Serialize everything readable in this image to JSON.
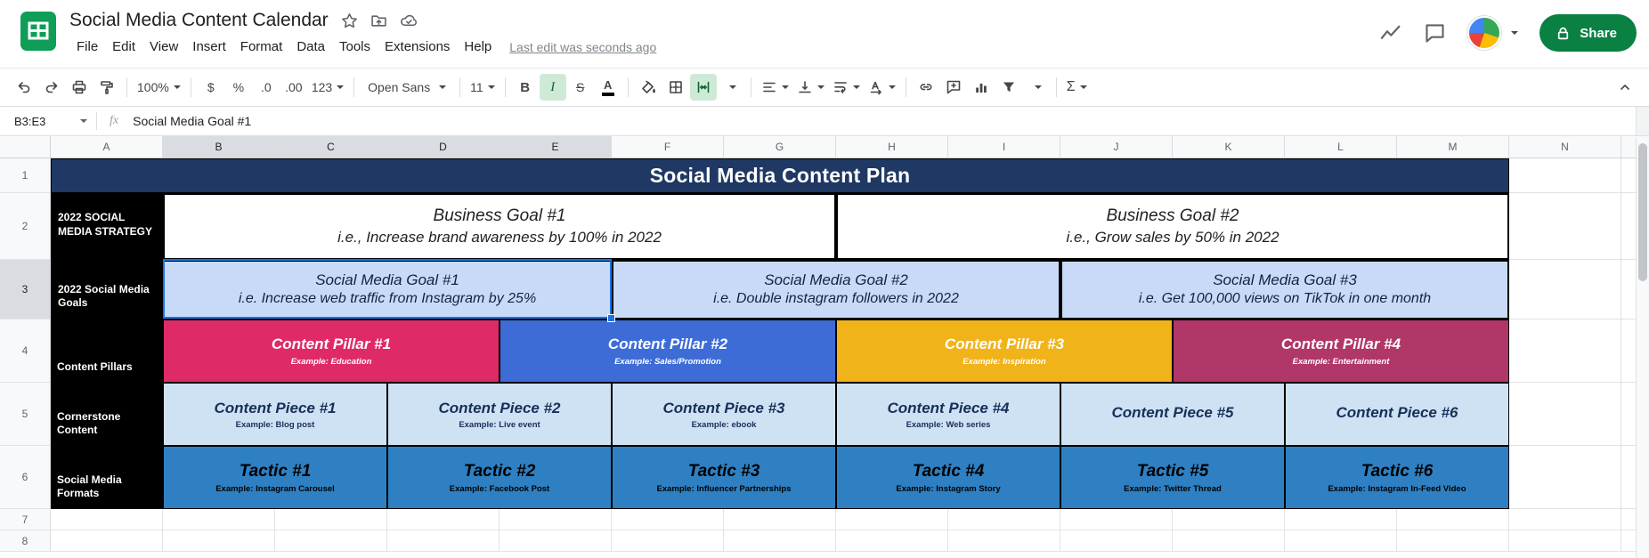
{
  "topbar": {
    "title": "Social Media Content Calendar",
    "menus": [
      "File",
      "Edit",
      "View",
      "Insert",
      "Format",
      "Data",
      "Tools",
      "Extensions",
      "Help"
    ],
    "last_edit": "Last edit was seconds ago",
    "share": "Share"
  },
  "toolbar": {
    "zoom": "100%",
    "currency": "$",
    "percent": "%",
    "decimal_decrease": ".0",
    "decimal_increase": ".00",
    "number_format": "123",
    "font_name": "Open Sans",
    "font_size": "11",
    "bold": "B",
    "italic": "I",
    "strikethrough": "S",
    "text_color": "A",
    "functions": "Σ"
  },
  "formula_bar": {
    "cell_ref": "B3:E3",
    "fx_label": "fx",
    "value": "Social Media Goal #1"
  },
  "grid": {
    "column_headers": [
      "A",
      "B",
      "C",
      "D",
      "E",
      "F",
      "G",
      "H",
      "I",
      "J",
      "K",
      "L",
      "M",
      "N"
    ],
    "row_headers": [
      "1",
      "2",
      "3",
      "4",
      "5",
      "6",
      "7",
      "8"
    ],
    "banner": "Social Media Content Plan",
    "row_labels": [
      "2022 SOCIAL MEDIA STRATEGY",
      "2022 Social Media Goals",
      "Content Pillars",
      "Cornerstone Content",
      "Social Media Formats"
    ],
    "business_goals": [
      {
        "title": "Business Goal #1",
        "subtitle": "i.e., Increase brand awareness by 100% in 2022"
      },
      {
        "title": "Business Goal #2",
        "subtitle": "i.e., Grow sales by 50% in 2022"
      }
    ],
    "social_goals": [
      {
        "title": "Social Media Goal #1",
        "subtitle": "i.e. Increase web traffic from Instagram by 25%"
      },
      {
        "title": "Social Media Goal #2",
        "subtitle": "i.e. Double instagram followers in 2022"
      },
      {
        "title": "Social Media Goal #3",
        "subtitle": "i.e. Get 100,000 views on TikTok in one month"
      }
    ],
    "content_pillars": [
      {
        "title": "Content Pillar #1",
        "subtitle": "Example: Education"
      },
      {
        "title": "Content Pillar #2",
        "subtitle": "Example: Sales/Promotion"
      },
      {
        "title": "Content Pillar #3",
        "subtitle": "Example: Inspiration"
      },
      {
        "title": "Content Pillar #4",
        "subtitle": "Example: Entertainment"
      }
    ],
    "content_pieces": [
      {
        "title": "Content Piece #1",
        "subtitle": "Example: Blog post"
      },
      {
        "title": "Content Piece #2",
        "subtitle": "Example: Live event"
      },
      {
        "title": "Content Piece #3",
        "subtitle": "Example: ebook"
      },
      {
        "title": "Content Piece #4",
        "subtitle": "Example: Web series"
      },
      {
        "title": "Content Piece #5",
        "subtitle": ""
      },
      {
        "title": "Content Piece #6",
        "subtitle": ""
      }
    ],
    "tactics": [
      {
        "title": "Tactic #1",
        "subtitle": "Example: Instagram Carousel"
      },
      {
        "title": "Tactic #2",
        "subtitle": "Example: Facebook Post"
      },
      {
        "title": "Tactic #3",
        "subtitle": "Example: Influencer Partnerships"
      },
      {
        "title": "Tactic #4",
        "subtitle": "Example: Instagram Story"
      },
      {
        "title": "Tactic #5",
        "subtitle": "Example: Twitter Thread"
      },
      {
        "title": "Tactic #6",
        "subtitle": "Example: Instagram In-Feed Video"
      }
    ],
    "colors": {
      "banner_bg": "#1f3864",
      "label_bg": "#000000",
      "goal_row_bg": "#c9daf8",
      "piece_row_bg": "#cfe2f3",
      "tactic_row_bg": "#2e80c2",
      "pillar_1": "#df2a68",
      "pillar_2": "#3d6cd7",
      "pillar_3": "#f1b31a",
      "pillar_4": "#b03768",
      "selection": "#1a73e8",
      "share_button": "#0b8043",
      "sheets_green": "#0f9d58"
    }
  }
}
